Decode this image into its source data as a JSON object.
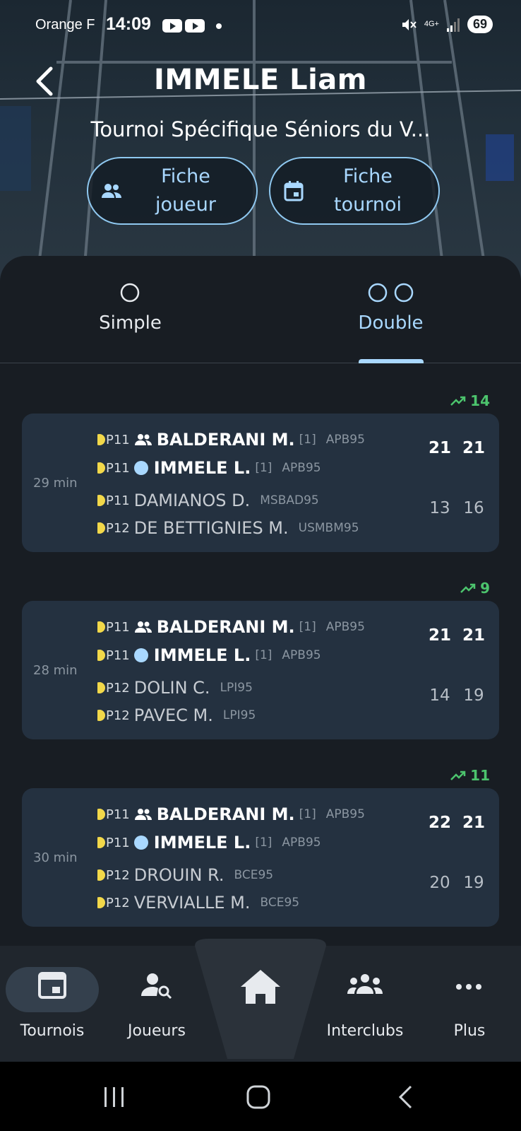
{
  "status_bar": {
    "carrier": "Orange F",
    "time": "14:09",
    "network": "4G+",
    "battery": "69"
  },
  "header": {
    "title": "IMMELE Liam",
    "subtitle": "Tournoi Spécifique Séniors du V...",
    "buttons": [
      {
        "label": "Fiche joueur",
        "icon": "players-icon"
      },
      {
        "label": "Fiche tournoi",
        "icon": "calendar-icon"
      }
    ]
  },
  "tabs": [
    {
      "label": "Simple",
      "icon": "single-circle-icon",
      "selected": false
    },
    {
      "label": "Double",
      "icon": "double-circle-icon",
      "selected": true
    }
  ],
  "matches": [
    {
      "trend": "14",
      "duration": "29 min",
      "team1": [
        {
          "rank": "P11",
          "name": "BALDERANI M.",
          "seed": "[1]",
          "club": "APB95",
          "marker": "partner"
        },
        {
          "rank": "P11",
          "name": "IMMELE L.",
          "seed": "[1]",
          "club": "APB95",
          "marker": "self"
        }
      ],
      "team2": [
        {
          "rank": "P11",
          "name": "DAMIANOS D.",
          "club": "MSBAD95"
        },
        {
          "rank": "P12",
          "name": "DE BETTIGNIES M.",
          "club": "USMBM95"
        }
      ],
      "scores1": [
        "21",
        "21"
      ],
      "scores2": [
        "13",
        "16"
      ]
    },
    {
      "trend": "9",
      "duration": "28 min",
      "team1": [
        {
          "rank": "P11",
          "name": "BALDERANI M.",
          "seed": "[1]",
          "club": "APB95",
          "marker": "partner"
        },
        {
          "rank": "P11",
          "name": "IMMELE L.",
          "seed": "[1]",
          "club": "APB95",
          "marker": "self"
        }
      ],
      "team2": [
        {
          "rank": "P12",
          "name": "DOLIN C.",
          "club": "LPI95"
        },
        {
          "rank": "P12",
          "name": "PAVEC M.",
          "club": "LPI95"
        }
      ],
      "scores1": [
        "21",
        "21"
      ],
      "scores2": [
        "14",
        "19"
      ]
    },
    {
      "trend": "11",
      "duration": "30 min",
      "team1": [
        {
          "rank": "P11",
          "name": "BALDERANI M.",
          "seed": "[1]",
          "club": "APB95",
          "marker": "partner"
        },
        {
          "rank": "P11",
          "name": "IMMELE L.",
          "seed": "[1]",
          "club": "APB95",
          "marker": "self"
        }
      ],
      "team2": [
        {
          "rank": "P12",
          "name": "DROUIN R.",
          "club": "BCE95"
        },
        {
          "rank": "P12",
          "name": "VERVIALLE M.",
          "club": "BCE95"
        }
      ],
      "scores1": [
        "22",
        "21"
      ],
      "scores2": [
        "20",
        "19"
      ]
    }
  ],
  "bottom_nav": [
    {
      "label": "Tournois",
      "icon": "calendar-icon",
      "active": true
    },
    {
      "label": "Joueurs",
      "icon": "user-search-icon",
      "active": false
    },
    {
      "label": "",
      "icon": "home-icon",
      "active": false
    },
    {
      "label": "Interclubs",
      "icon": "groups-icon",
      "active": false
    },
    {
      "label": "Plus",
      "icon": "more-dots-icon",
      "active": false
    }
  ],
  "colors": {
    "accent": "#a9d8ff",
    "trend_up": "#4cc46d",
    "card": "#243140",
    "background": "#181d23",
    "shuttle_rank": "#f2d84a"
  }
}
